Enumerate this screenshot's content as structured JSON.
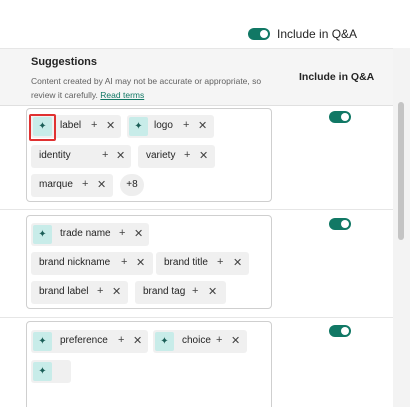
{
  "top": {
    "toggle_label": "Include in Q&A",
    "toggle_on": true
  },
  "header": {
    "title": "Suggestions",
    "note": "Content created by AI may not be accurate or appropriate, so review it carefully.",
    "link": "Read terms",
    "column": "Include in Q&A"
  },
  "colors": {
    "accent": "#117865",
    "ai_badge": "#c8ece9",
    "highlight": "#e03131"
  },
  "icons": {
    "ai": "sparkle-icon",
    "add": "plus-icon",
    "remove": "close-icon"
  },
  "rows": [
    {
      "toggle_on": true,
      "chips": [
        {
          "label": "label",
          "ai": true
        },
        {
          "label": "logo",
          "ai": true
        },
        {
          "label": "identity",
          "ai": false
        },
        {
          "label": "variety",
          "ai": false
        },
        {
          "label": "marque",
          "ai": false
        }
      ],
      "more": "+8"
    },
    {
      "toggle_on": true,
      "chips": [
        {
          "label": "trade name",
          "ai": true
        },
        {
          "label": "brand nickname",
          "ai": false
        },
        {
          "label": "brand title",
          "ai": false
        },
        {
          "label": "brand label",
          "ai": false
        },
        {
          "label": "brand tag",
          "ai": false
        }
      ]
    },
    {
      "toggle_on": true,
      "chips": [
        {
          "label": "preference",
          "ai": true
        },
        {
          "label": "choice",
          "ai": true
        }
      ]
    }
  ],
  "glyphs": {
    "plus": "+",
    "x": "✕",
    "sparkle": "✦"
  }
}
